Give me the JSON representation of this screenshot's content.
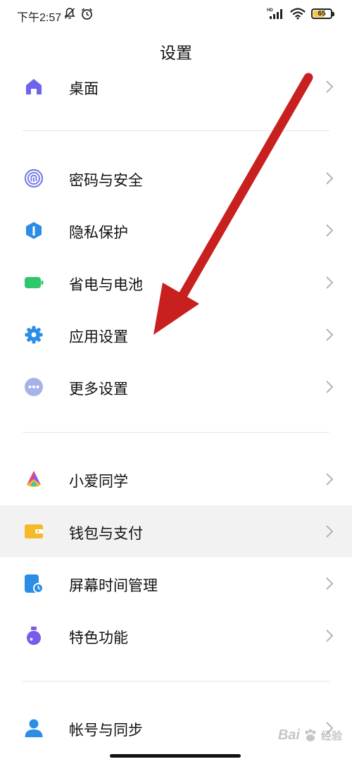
{
  "status_bar": {
    "time": "下午2:57",
    "network_label": "HD",
    "battery_level": 65,
    "battery_text": "65"
  },
  "header": {
    "title": "设置"
  },
  "settings": [
    {
      "id": "desktop",
      "label": "桌面",
      "icon": "home-icon",
      "color": "#6e63ec"
    },
    {
      "id": "password-security",
      "label": "密码与安全",
      "icon": "fingerprint-icon",
      "color": "#7b7ce6"
    },
    {
      "id": "privacy",
      "label": "隐私保护",
      "icon": "shield-icon",
      "color": "#2b8de6"
    },
    {
      "id": "battery",
      "label": "省电与电池",
      "icon": "battery-icon",
      "color": "#2fc76b"
    },
    {
      "id": "app-settings",
      "label": "应用设置",
      "icon": "gear-icon",
      "color": "#2b8de6"
    },
    {
      "id": "more-settings",
      "label": "更多设置",
      "icon": "more-dots-icon",
      "color": "#a7b3e8"
    },
    {
      "id": "xiaoai",
      "label": "小爱同学",
      "icon": "xiaoai-icon",
      "color": "#e8467a"
    },
    {
      "id": "wallet",
      "label": "钱包与支付",
      "icon": "wallet-icon",
      "color": "#f5b92a"
    },
    {
      "id": "screen-time",
      "label": "屏幕时间管理",
      "icon": "screen-time-icon",
      "color": "#2b8de6"
    },
    {
      "id": "special-features",
      "label": "特色功能",
      "icon": "flask-icon",
      "color": "#7a5cea"
    },
    {
      "id": "account-sync",
      "label": "帐号与同步",
      "icon": "user-icon",
      "color": "#2b8de6"
    }
  ],
  "annotation": {
    "arrow_color": "#c8201f"
  },
  "watermark": {
    "brand": "Bai",
    "suffix": "经验"
  }
}
